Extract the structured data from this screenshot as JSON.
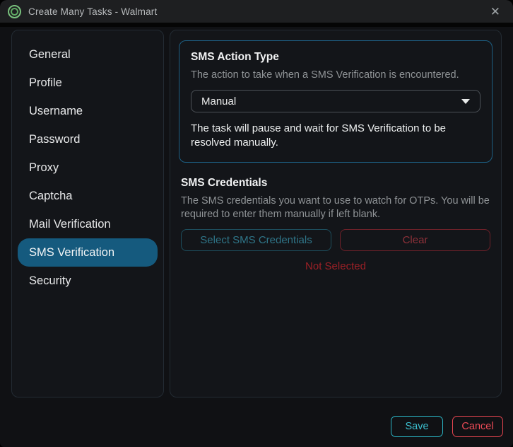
{
  "window": {
    "title": "Create Many Tasks - Walmart",
    "close_icon": "✕"
  },
  "colors": {
    "accent_teal": "#2ab4c4",
    "accent_red": "#e64550",
    "selected_item_blue": "#155a7e",
    "muted_teal_text": "#2f7588",
    "muted_red_text": "#8d3139",
    "status_red": "#9c2026",
    "app_icon_green": "#79c07d"
  },
  "sidebar": {
    "items": [
      {
        "label": "General",
        "selected": false
      },
      {
        "label": "Profile",
        "selected": false
      },
      {
        "label": "Username",
        "selected": false
      },
      {
        "label": "Password",
        "selected": false
      },
      {
        "label": "Proxy",
        "selected": false
      },
      {
        "label": "Captcha",
        "selected": false
      },
      {
        "label": "Mail Verification",
        "selected": false
      },
      {
        "label": "SMS Verification",
        "selected": true
      },
      {
        "label": "Security",
        "selected": false
      }
    ]
  },
  "main": {
    "action_type": {
      "title": "SMS Action Type",
      "description": "The action to take when a SMS Verification is encountered.",
      "dropdown_value": "Manual",
      "note": "The task will pause and wait for SMS Verification to be resolved manually."
    },
    "credentials": {
      "title": "SMS Credentials",
      "description": "The SMS credentials you want to use to watch for OTPs. You will be required to enter them manually if left blank.",
      "select_button": "Select SMS Credentials",
      "clear_button": "Clear",
      "status": "Not Selected"
    }
  },
  "footer": {
    "save_label": "Save",
    "cancel_label": "Cancel"
  }
}
